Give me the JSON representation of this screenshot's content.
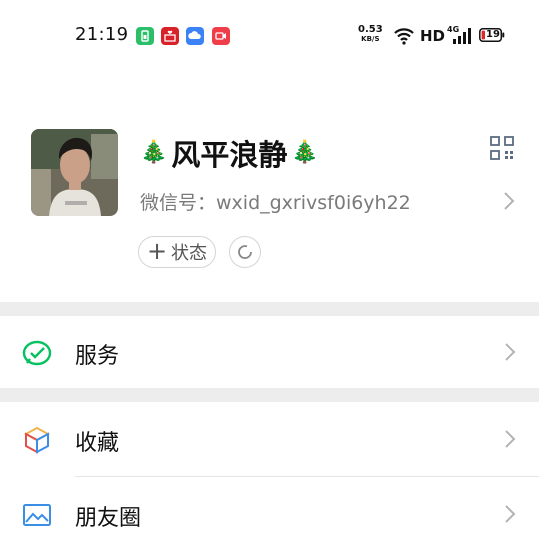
{
  "status_bar": {
    "time": "21:19",
    "net_speed": "0.53",
    "net_unit": "KB/S",
    "hd": "HD",
    "signal_type": "4G",
    "battery": "19",
    "notification_icons": [
      "wallet-app-icon",
      "gift-app-icon",
      "cloud-app-icon",
      "video-app-icon"
    ],
    "colors": {
      "notif1": "#2bbf6a",
      "notif2": "#d8222a",
      "notif3": "#3b82f6",
      "notif4": "#ef3e4a"
    }
  },
  "profile": {
    "nickname": "风平浪静",
    "wechat_id": "微信号：wxid_gxrivsf0i6yh22",
    "status_button": "状态",
    "status_plus": "+"
  },
  "menu": {
    "services": "服务",
    "favorites": "收藏",
    "moments": "朋友圈"
  },
  "colors": {
    "accent_green": "#07c160",
    "section_gap": "#ededed",
    "secondary_text": "#7a7a7a"
  }
}
